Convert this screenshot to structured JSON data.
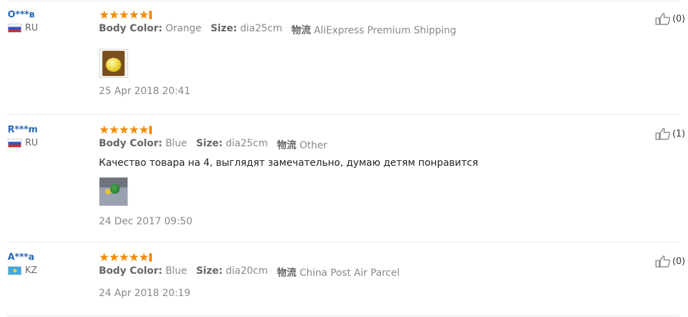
{
  "reviews": [
    {
      "user": "O***в",
      "country": "RU",
      "flag": "russia-flag",
      "stars": "★★★★★",
      "attrs": [
        {
          "label": "Body Color:",
          "value": "Orange"
        },
        {
          "label": "Size:",
          "value": "dia25cm"
        }
      ],
      "shipping_label": "物流",
      "shipping_value": "AliExpress Premium Shipping",
      "text": "",
      "has_photo": true,
      "date": "25 Apr 2018 20:41",
      "helpful": "(0)"
    },
    {
      "user": "R***m",
      "country": "RU",
      "flag": "russia-flag",
      "stars": "★★★★★",
      "attrs": [
        {
          "label": "Body Color:",
          "value": "Blue"
        },
        {
          "label": "Size:",
          "value": "dia25cm"
        }
      ],
      "shipping_label": "物流",
      "shipping_value": "Other",
      "text": "Качество товара на 4, выглядят замечательно, думаю детям понравится",
      "has_photo": true,
      "date": "24 Dec 2017 09:50",
      "helpful": "(1)"
    },
    {
      "user": "A***a",
      "country": "KZ",
      "flag": "kazakhstan-flag",
      "stars": "★★★★★",
      "attrs": [
        {
          "label": "Body Color:",
          "value": "Blue"
        },
        {
          "label": "Size:",
          "value": "dia20cm"
        }
      ],
      "shipping_label": "物流",
      "shipping_value": "China Post Air Parcel",
      "text": "",
      "has_photo": false,
      "date": "24 Apr 2018 20:19",
      "helpful": "(0)"
    }
  ],
  "colors": {
    "star": "#f58a00",
    "username": "#2a68b6",
    "divider": "#e8e8e8"
  }
}
